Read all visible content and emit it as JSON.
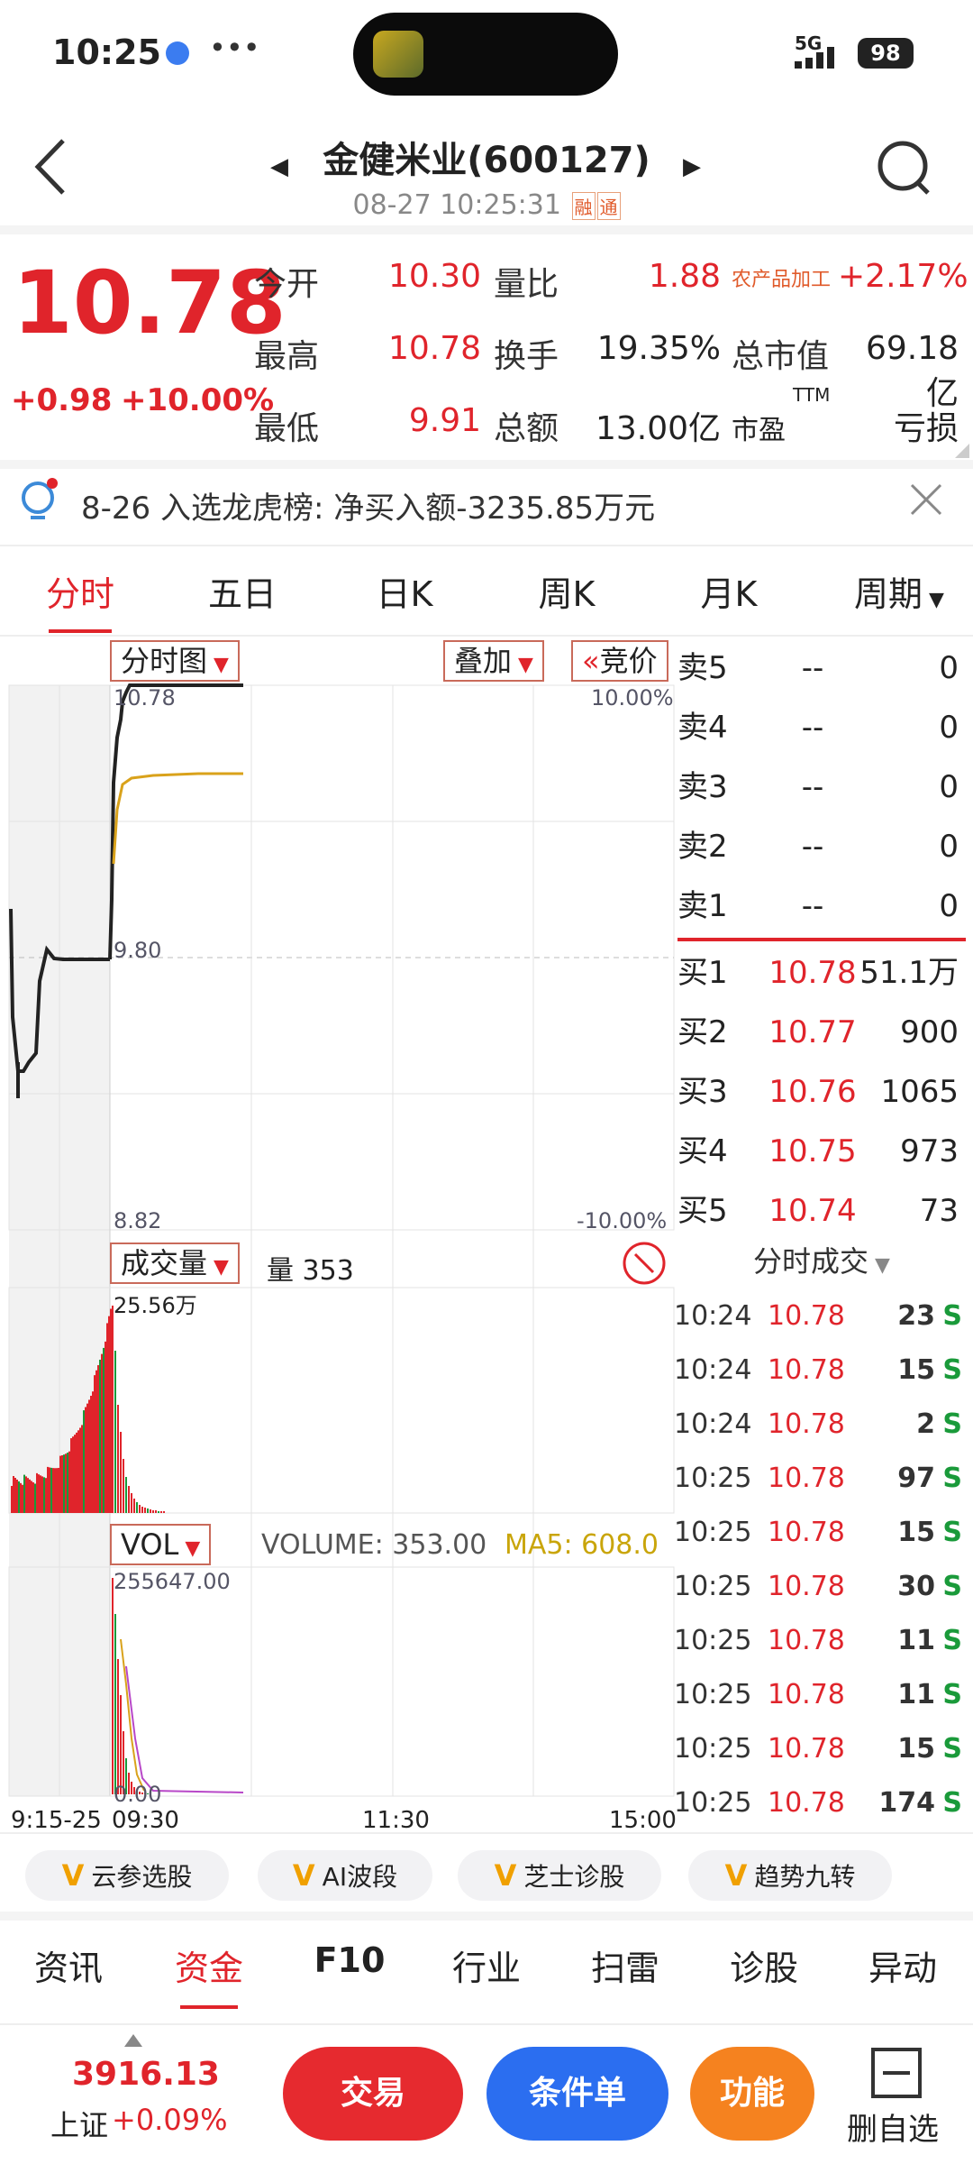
{
  "status_bar": {
    "time": "10:25",
    "battery": "98",
    "signal": "5G"
  },
  "header": {
    "title": "金健米业(600127)",
    "subtitle": "08-27 10:25:31",
    "tag1": "融",
    "tag2": "通"
  },
  "quote": {
    "price": "10.78",
    "change": "+0.98",
    "change_pct": "+10.00%",
    "open_label": "今开",
    "open": "10.30",
    "high_label": "最高",
    "high": "10.78",
    "low_label": "最低",
    "low": "9.91",
    "vr_label": "量比",
    "vr": "1.88",
    "turnover_label": "换手",
    "turnover": "19.35%",
    "amount_label": "总额",
    "amount": "13.00亿",
    "sector": "农产品加工",
    "sector_pct": "+2.17%",
    "mcap_label": "总市值",
    "mcap": "69.18亿",
    "pe_label": "市盈",
    "pe_sup": "TTM",
    "pe": "亏损"
  },
  "notice": {
    "text": "8-26 入选龙虎榜: 净买入额-3235.85万元"
  },
  "tabs": [
    "分时",
    "五日",
    "日K",
    "周K",
    "月K",
    "周期"
  ],
  "chart": {
    "minute_btn": "分时图",
    "overlay_btn": "叠加",
    "auction_btn": "竞价",
    "price_high": "10.78",
    "price_mid": "9.80",
    "price_low": "8.82",
    "pct_high": "10.00%",
    "pct_low": "-10.00%",
    "vol_btn": "成交量",
    "vol_text": "量 353",
    "vol_max": "25.56万",
    "vol2_btn": "VOL",
    "vol2_text": "VOLUME: 353.00",
    "ma5_text": "MA5: 608.0",
    "vol2_max": "255647.00",
    "vol2_min": "0.00",
    "x_labels": [
      "9:15-25",
      "09:30",
      "11:30",
      "15:00"
    ]
  },
  "orderbook": {
    "asks": [
      {
        "label": "卖5",
        "price": "--",
        "vol": "0"
      },
      {
        "label": "卖4",
        "price": "--",
        "vol": "0"
      },
      {
        "label": "卖3",
        "price": "--",
        "vol": "0"
      },
      {
        "label": "卖2",
        "price": "--",
        "vol": "0"
      },
      {
        "label": "卖1",
        "price": "--",
        "vol": "0"
      }
    ],
    "bids": [
      {
        "label": "买1",
        "price": "10.78",
        "vol": "51.1万"
      },
      {
        "label": "买2",
        "price": "10.77",
        "vol": "900"
      },
      {
        "label": "买3",
        "price": "10.76",
        "vol": "1065"
      },
      {
        "label": "买4",
        "price": "10.75",
        "vol": "973"
      },
      {
        "label": "买5",
        "price": "10.74",
        "vol": "73"
      }
    ]
  },
  "ticks_title": "分时成交",
  "ticks": [
    {
      "time": "10:24",
      "price": "10.78",
      "vol": "23",
      "side": "S"
    },
    {
      "time": "10:24",
      "price": "10.78",
      "vol": "15",
      "side": "S"
    },
    {
      "time": "10:24",
      "price": "10.78",
      "vol": "2",
      "side": "S"
    },
    {
      "time": "10:25",
      "price": "10.78",
      "vol": "97",
      "side": "S"
    },
    {
      "time": "10:25",
      "price": "10.78",
      "vol": "15",
      "side": "S"
    },
    {
      "time": "10:25",
      "price": "10.78",
      "vol": "30",
      "side": "S"
    },
    {
      "time": "10:25",
      "price": "10.78",
      "vol": "11",
      "side": "S"
    },
    {
      "time": "10:25",
      "price": "10.78",
      "vol": "11",
      "side": "S"
    },
    {
      "time": "10:25",
      "price": "10.78",
      "vol": "15",
      "side": "S"
    },
    {
      "time": "10:25",
      "price": "10.78",
      "vol": "174",
      "side": "S"
    }
  ],
  "chips": [
    "云参选股",
    "AI波段",
    "芝士诊股",
    "趋势九转"
  ],
  "chip_badge": "V",
  "bottom_tabs": [
    "资讯",
    "资金",
    "F10",
    "行业",
    "扫雷",
    "诊股",
    "异动"
  ],
  "footer": {
    "index_value": "3916.13",
    "index_name": "上证",
    "index_pct": "+0.09%",
    "trade_btn": "交易",
    "cond_btn": "条件单",
    "func_btn": "功能",
    "del_btn": "删自选"
  },
  "colors": {
    "up": "#e0242b",
    "down": "#1a9a3a",
    "accent": "#e0242b",
    "blue_btn": "#2b6ef0",
    "orange_btn": "#f5821f"
  }
}
